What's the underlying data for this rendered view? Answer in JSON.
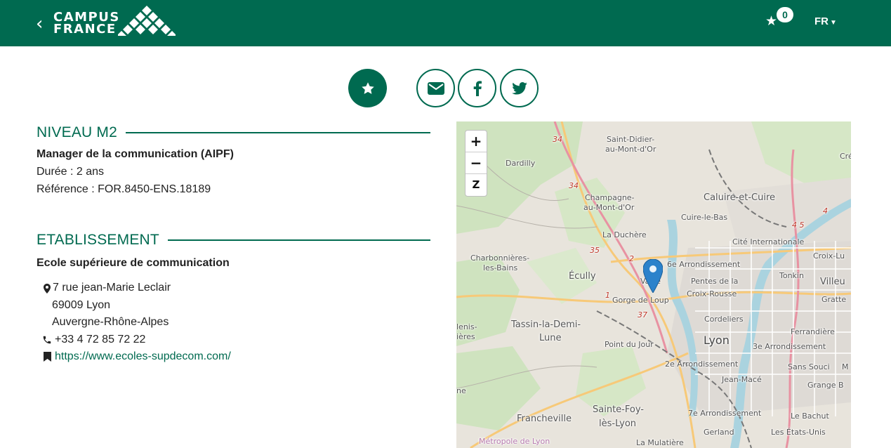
{
  "header": {
    "back_icon": "chevron-left-icon",
    "logo_line1": "CAMPUS",
    "logo_line2": "FRANCE",
    "favorites_icon": "star-icon",
    "favorites_count": "0",
    "language": "FR",
    "brand_color": "#006a50"
  },
  "share": {
    "favorite_icon": "star-icon",
    "email_icon": "envelope-icon",
    "facebook_icon": "facebook-icon",
    "twitter_icon": "twitter-icon"
  },
  "niveau": {
    "title": "NIVEAU M2",
    "program": "Manager de la communication (AIPF)",
    "duration": "Durée : 2 ans",
    "reference": "Référence : FOR.8450-ENS.18189"
  },
  "etablissement": {
    "title": "ETABLISSEMENT",
    "name": "Ecole supérieure de communication",
    "address_line1": "7 rue jean-Marie Leclair",
    "address_line2": "69009 Lyon",
    "address_line3": "Auvergne-Rhône-Alpes",
    "phone": "+33 4 72 85 72 22",
    "website": "https://www.ecoles-supdecom.com/"
  },
  "map": {
    "zoom_in": "+",
    "zoom_out": "−",
    "reset": "Z",
    "labels": {
      "saint_didier": "Saint-Didier-",
      "saint_didier2": "au-Mont-d'Or",
      "dardilly": "Dardilly",
      "champagne": "Champagne-",
      "champagne2": "au-Mont-d'Or",
      "caluire": "Caluire-et-Cuire",
      "cuire_le_bas": "Cuire-le-Bas",
      "la_duchere": "La Duchère",
      "cite_internationale": "Cité Internationale",
      "charbonnieres": "Charbonnières-",
      "charbonnieres2": "les-Bains",
      "ecully": "Écully",
      "vaise": "Vaise",
      "arr6": "6e Arrondissement",
      "croix_lu": "Croix-Lu",
      "tonkin": "Tonkin",
      "villeu": "Villeu",
      "pentes": "Pentes de la",
      "pentes2": "Croix-Rousse",
      "gorge": "Gorge de Loup",
      "gratte": "Gratte",
      "tassin": "Tassin-la-Demi-",
      "tassin2": "Lune",
      "cordeliers": "Cordeliers",
      "ferrandiere": "Ferrandière",
      "lenis": "lenis-",
      "ieres": "ières",
      "point_du_jour": "Point du Jour",
      "lyon": "Lyon",
      "arr3": "3e Arrondissement",
      "arr2": "2e Arrondissement",
      "sans_souci": "Sans Souci",
      "m": "M",
      "jean_mace": "Jean-Macé",
      "grange": "Grange B",
      "ne": "ne",
      "sainte_foy": "Sainte-Foy-",
      "sainte_foy2": "lès-Lyon",
      "francheville": "Francheville",
      "arr7": "7e Arrondissement",
      "le_bachut": "Le Bachut",
      "gerland": "Gerland",
      "etats_unis": "Les États-Unis",
      "metropole": "Métropole de Lyon",
      "la_mulatiere": "La Mulatière",
      "cre": "Cré",
      "r34a": "34",
      "r34b": "34",
      "r35": "35",
      "r2": "2",
      "r37": "37",
      "r4": "4",
      "r45": "4 5",
      "r1": "1"
    },
    "marker_icon": "map-marker-icon"
  }
}
